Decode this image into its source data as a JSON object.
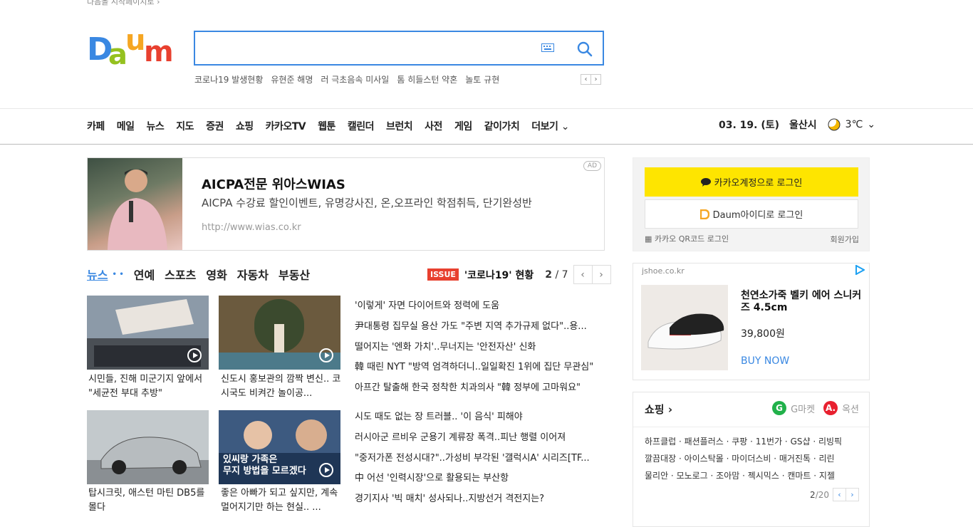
{
  "top_link": "다음을 시작페이지로 ›",
  "logo_text": "Daum",
  "search": {
    "placeholder": ""
  },
  "trending": [
    "코로나19 발생현황",
    "유현준 해명",
    "러 극초음속 미사일",
    "톰 히들스턴 약혼",
    "놀토 규현"
  ],
  "gnb": [
    "카페",
    "메일",
    "뉴스",
    "지도",
    "증권",
    "쇼핑",
    "카카오TV",
    "웹툰",
    "캘린더",
    "브런치",
    "사전",
    "게임",
    "같이가치",
    "더보기"
  ],
  "date": "03. 19. (토)",
  "location": "울산시",
  "temperature": "3℃",
  "ad_main": {
    "title": "AICPA전문 위아스WIAS",
    "desc": "AICPA 수강료 할인이벤트, 유명강사진, 온,오프라인 학점취득, 단기완성반",
    "url": "http://www.wias.co.kr",
    "badge": "AD"
  },
  "news_tabs": [
    "뉴스",
    "연예",
    "스포츠",
    "영화",
    "자동차",
    "부동산"
  ],
  "issue": {
    "badge": "ISSUE",
    "title": "'코로나19' 현황",
    "current": "2",
    "total": "/ 7"
  },
  "thumbs": [
    {
      "caption": "시민들, 진해 미군기지 앞에서 \"세균전 부대 추방\"",
      "color": "#7a8c9a"
    },
    {
      "caption": "신도시 홍보관의 깜짝 변신.. 코시국도 비켜간 놀이공...",
      "color": "#6b5a3e"
    },
    {
      "caption": "탑시크릿, 애스턴 마틴 DB5를 몰다",
      "color": "#9aa3a8"
    },
    {
      "caption": "좋은 아빠가 되고 싶지만, 계속 멀어지기만 하는 현실.. ...",
      "color": "#3d5a80"
    }
  ],
  "thumb_overlay_text": "있씨랑 가족은\n무지 방법을 모르겠다",
  "headlines": [
    "'이렇게' 자면 다이어트와 정력에 도움",
    "尹대통령 집무실 용산 가도 \"주변 지역 추가규제 없다\"..용...",
    "떨어지는 '엔화 가치'..무너지는 '안전자산' 신화",
    "韓 때린 NYT \"방역 엄격하더니..일일확진 1위에 집단 무관심\"",
    "아프간 탈출해 한국 정착한 치과의사 \"韓 정부에 고마워요\"",
    "시도 때도 없는 장 트러블.. '이 음식' 피해야",
    "러시아군 르비우 군용기 계류장 폭격..피난 행렬 이어져",
    "\"중저가폰 전성시대?\"..가성비 부각된 '갤럭시A' 시리즈[TF...",
    "中 어선 '인력시장'으로 활용되는 부산항",
    "경기지사 '빅 매치' 성사되나..지방선거 격전지는?"
  ],
  "login": {
    "kakao_label": "카카오계정으로 로그인",
    "daum_label": "Daum아이디로 로그인",
    "qr_label": "카카오 QR코드 로그인",
    "signup_label": "회원가입"
  },
  "ad_side": {
    "domain": "jshoe.co.kr",
    "title": "천연소가죽 벨키 에어 스니커즈 4.5cm",
    "price": "39,800원",
    "cta": "BUY NOW"
  },
  "shopping": {
    "title": "쇼핑 ›",
    "partner1": "G마켓",
    "partner2": "옥션",
    "lines": [
      "하프클럽 · 패션플러스 · 쿠팡 · 11번가 · GS샵 · 리빙픽",
      "깔끔대장 · 아이스탁몰 · 마이더스비 · 매거진톡 · 리린",
      "물리안 · 모노로그 · 조아맘 · 젝시믹스 · 캔마트 · 지젤"
    ],
    "page_current": "2",
    "page_total": "/20"
  }
}
